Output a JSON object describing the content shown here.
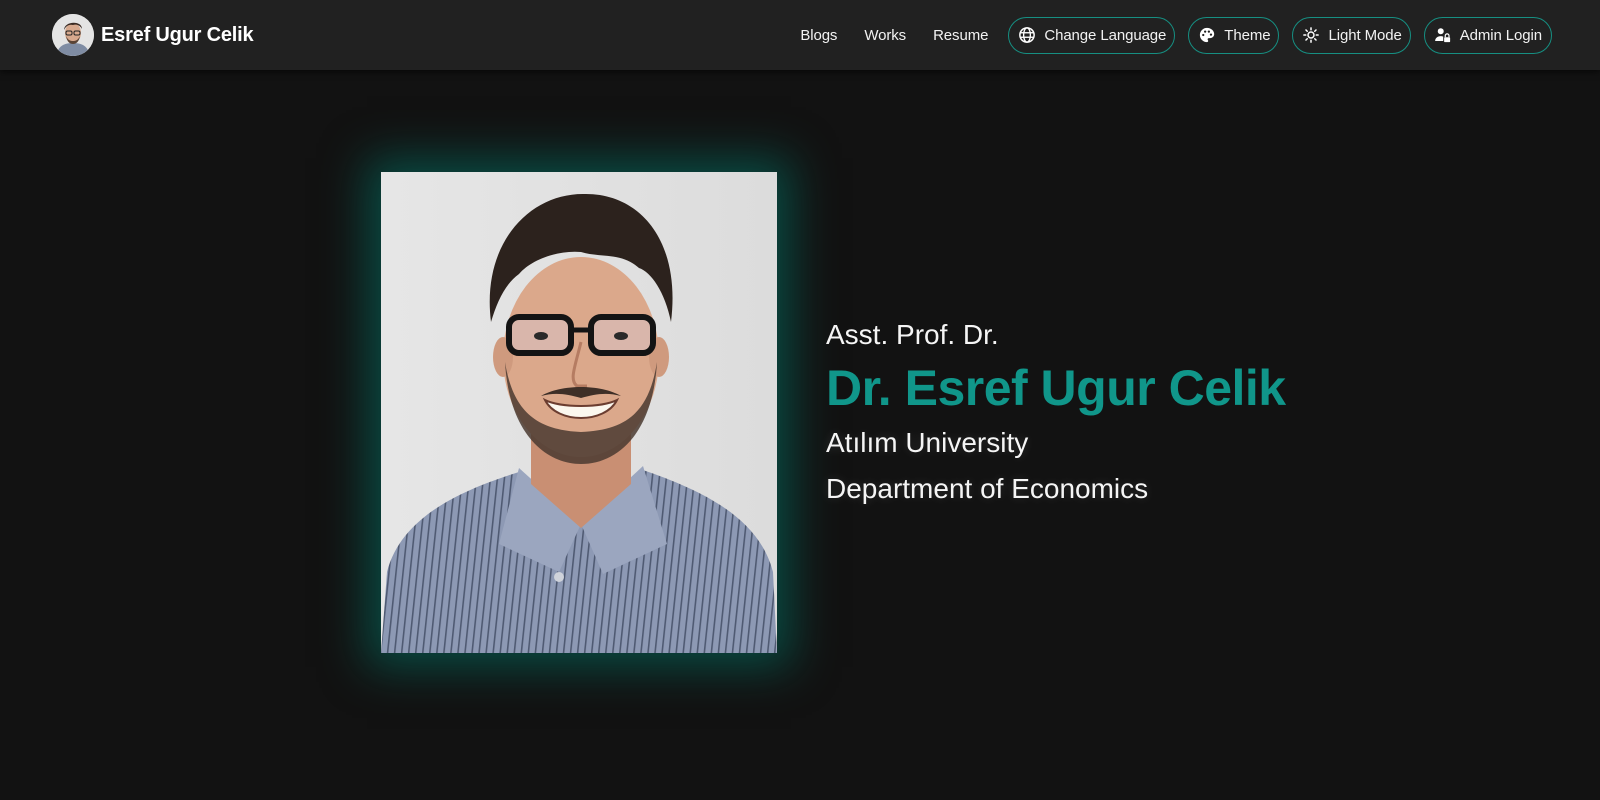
{
  "brand": {
    "name": "Esref Ugur Celik",
    "avatar_icon": "profile-avatar"
  },
  "nav": {
    "links": [
      "Blogs",
      "Works",
      "Resume"
    ],
    "change_language": {
      "label": "Change Language",
      "icon": "globe-icon"
    },
    "theme": {
      "label": "Theme",
      "icon": "palette-icon"
    },
    "light_mode": {
      "label": "Light Mode",
      "icon": "sun-icon"
    },
    "admin_login": {
      "label": "Admin Login",
      "icon": "admin-user-icon"
    }
  },
  "hero": {
    "title_prefix": "Asst. Prof. Dr.",
    "name": "Dr. Esref Ugur Celik",
    "university": "Atılım University",
    "department": "Department of Economics",
    "portrait_icon": "profile-photo"
  },
  "colors": {
    "background": "#121212",
    "appbar": "#212121",
    "accent": "#10968a",
    "pill_border": "#168f82",
    "glow": "#007a6c"
  }
}
